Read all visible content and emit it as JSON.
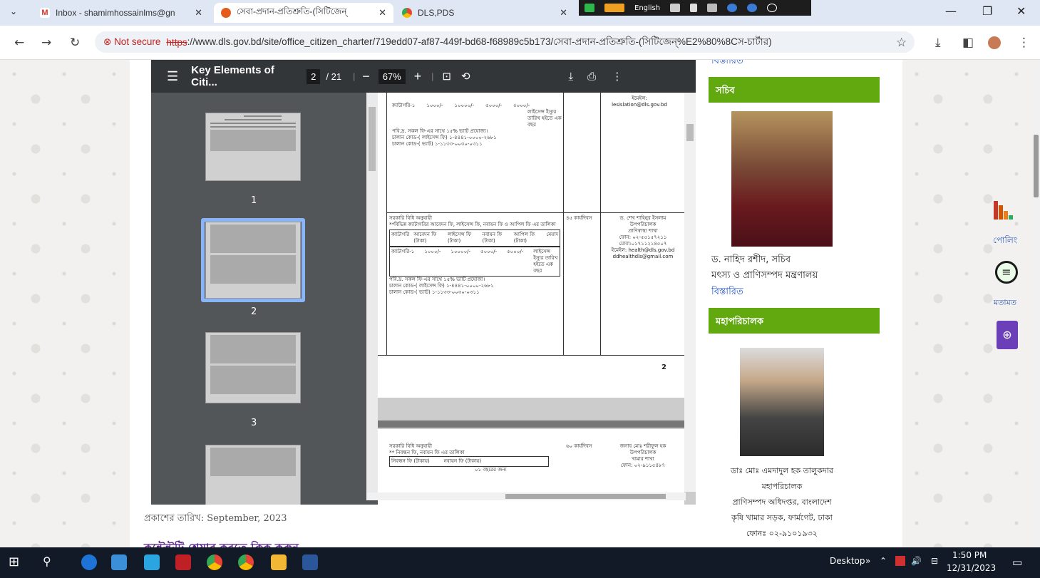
{
  "browser": {
    "tabs": [
      {
        "title": "Inbox - shamimhossainlms@gn",
        "favicon": "gmail-icon"
      },
      {
        "title": "সেবা-প্রদান-প্রতিশ্রুতি-(সিটিজেন্",
        "favicon": "dls-icon",
        "active": true
      },
      {
        "title": "DLS,PDS",
        "favicon": "chrome-icon"
      }
    ],
    "lang_label": "English",
    "security": "Not secure",
    "url_scheme": "https",
    "url_rest": "://www.dls.gov.bd/site/office_citizen_charter/719edd07-af87-449f-bd68-f68989c5b173/সেবা-প্রদান-প্রতিশ্রুতি-(সিটিজেন্%E2%80%8Cস-চার্টার)"
  },
  "pdf": {
    "title": "Key Elements of Citi...",
    "page": "2",
    "total": "/ 21",
    "zoom": "67%",
    "thumb_labels": [
      "1",
      "2",
      "3"
    ],
    "page_number": "2",
    "rows": {
      "row1_cat": "ক্যাটাগরি-১",
      "row1_fees": [
        "১০০০/-",
        "১০০০০/-",
        "৫০০০/-",
        "৫০০০/-"
      ],
      "validity": "লাইসেন্স ইস্যুর তারিখ হইতে এক বছর",
      "vat_note": "পবি.দ্র. সকল ফি-এর সাথে ১৫% ভ্যাট প্রযোজ্য।",
      "challan1": "চালান কোড-( লাইসেন্স ফি) ১-৪৪৪১-০০০০-২৬৮১",
      "challan2": "চালান কোড-( ভ্যাট) ১-১১৩৩-০০৩০-০৩১১",
      "email_label": "ইমেইল:",
      "email1": "lesislation@dls.gov.bd",
      "gov_rule": "সরকারি বিধি অনুযায়ী",
      "gov_rule_desc": "**বিভিন্ন ক্যাটাগরির আবেদন ফি, লাইসেন্স ফি, নবায়ন ফি ও আপিল ফি এর তালিকা",
      "headers": [
        "ক্যাটাগরি",
        "আবেদন ফি (টাকা)",
        "লাইসেন্স ফি (টাকা)",
        "নবায়ন ফি (টাকা)",
        "আপিল ফি (টাকা)",
        "মেয়াদ"
      ],
      "days45": "৪৫ কার্যদিবস",
      "officer": "ড. শেখ শাহিনুর ইসলাম",
      "officer_title": "উপপরিচালক",
      "officer_branch": "প্রাণিস্বাস্থ্য শাখা",
      "officer_phone": "ফোন: ০২-৫৫১৫৭২১১",
      "officer_mobile": "মোবা:০১৭১১২১৪৫০৭",
      "email2": "ইমেইল: health@dls.gov.bd",
      "email3": "ddhealthdls@gmail.com",
      "reg_fee": "** নিবন্ধন ফি, নবায়ন ফি এর তালিকা",
      "reg_fee_h1": "নিবন্ধন ফি (টাকায়)",
      "reg_fee_h2": "নবায়ন ফি (টাকায়)",
      "reg_fee_h3": "০১ বছরের জন্য",
      "days60": "৬০ কার্যদিবস",
      "officer2": "জনাব মোঃ শরীফুল হক",
      "officer2_title": "উপপরিচালক",
      "officer2_branch": "খামার শাখা",
      "officer2_phone": "ফোন: ০২-৯১১৫৪৮৭"
    }
  },
  "publish_date": "প্রকাশের তারিখ: September, 2023",
  "cut_heading": "কন্টেন্টটি শেয়ার করতে ক্লিক করুন",
  "sidebar": {
    "top_link": "বিস্তারিত",
    "secretary": {
      "heading": "সচিব",
      "name": "ড. নাহিদ রশীদ, সচিব",
      "ministry": "মৎস্য ও প্রাণিসম্পদ মন্ত্রণালয়",
      "more": "বিস্তারিত"
    },
    "dg": {
      "heading": "মহাপরিচালক",
      "name": "ডাঃ মোঃ এমদাদুল হক তালুকদার",
      "title": "মহাপরিচালক",
      "dept": "প্রাণিসম্পদ অধিদপ্তর, বাংলাদেশ",
      "address": "কৃষি খামার সড়ক, ফার্মগেট, ঢাকা",
      "phone": "ফোনঃ ০২-৯১০১৯৩২"
    }
  },
  "right_widgets": {
    "poll": "পোলিং",
    "feedback": "মতামত"
  },
  "taskbar": {
    "desktop": "Desktop",
    "time": "1:50 PM",
    "date": "12/31/2023"
  }
}
